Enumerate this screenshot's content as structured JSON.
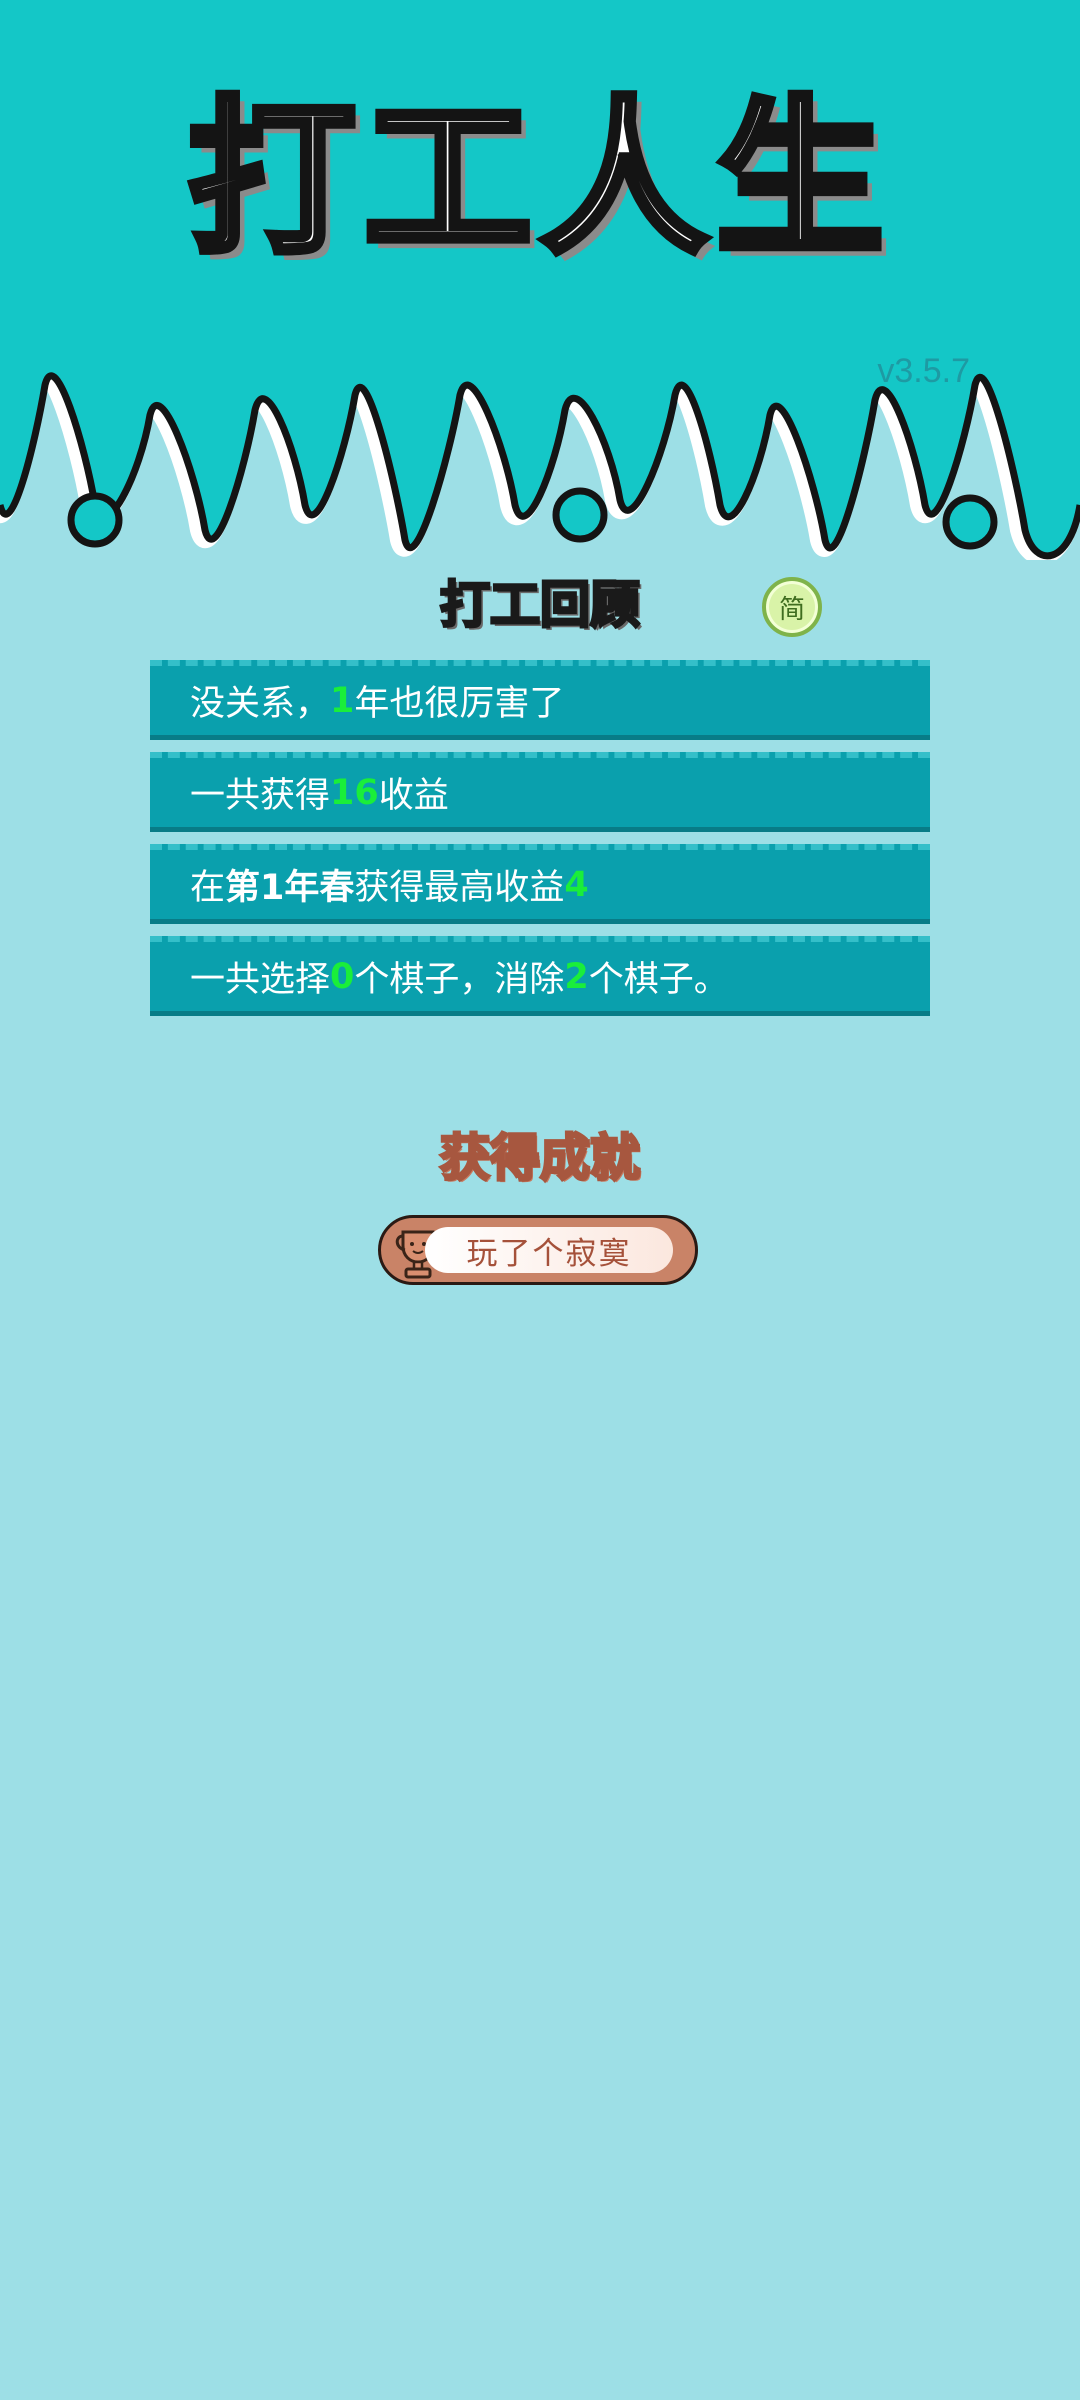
{
  "header": {
    "title": "打工人生",
    "version": "v3.5.7"
  },
  "review": {
    "title": "打工回顾",
    "lang_toggle": "简",
    "rows": [
      {
        "a": "没关系，",
        "b": "1",
        "c": "年也很厉害了"
      },
      {
        "a": "一共获得",
        "b": "16",
        "c": "收益"
      },
      {
        "a": "在 ",
        "b": "第1年春",
        "c": " 获得最高收益",
        "d": "4"
      },
      {
        "a": "一共选择",
        "b": "0",
        "c": "个棋子，消除",
        "d": "2",
        "e": "个棋子。"
      }
    ]
  },
  "achievements": {
    "title": "获得成就",
    "items": [
      {
        "label": "玩了个寂寞",
        "icon": "trophy-icon"
      }
    ]
  },
  "colors": {
    "background": "#9ddfe6",
    "header": "#14c7c7",
    "row": "#0aa0ad",
    "highlight": "#1aee3a",
    "achievement": "#c98367"
  }
}
